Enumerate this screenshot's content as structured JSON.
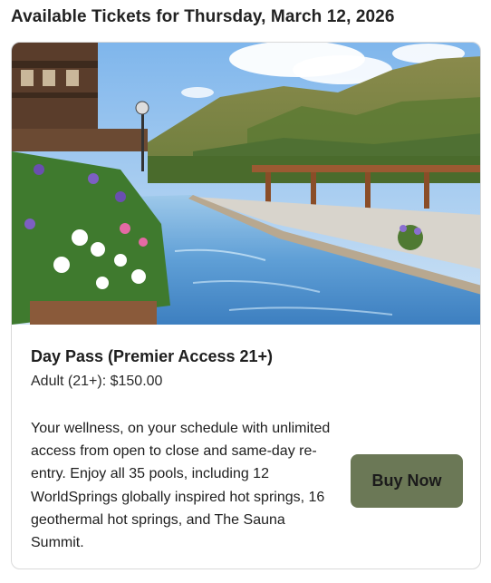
{
  "heading": "Available Tickets for Thursday, March 12, 2026",
  "ticket": {
    "name": "Day Pass (Premier Access 21+)",
    "price_line": "Adult (21+): $150.00",
    "description": "Your wellness, on your schedule with unlimited access from open to close and same-day re-entry. Enjoy all 35 pools, including 12 WorldSprings globally inspired hot springs, 16 geothermal hot springs, and The Sauna Summit.",
    "buy_label": "Buy Now"
  },
  "colors": {
    "button_bg": "#6b7856",
    "card_border": "#d9d9d9",
    "text": "#1e1e1e"
  }
}
